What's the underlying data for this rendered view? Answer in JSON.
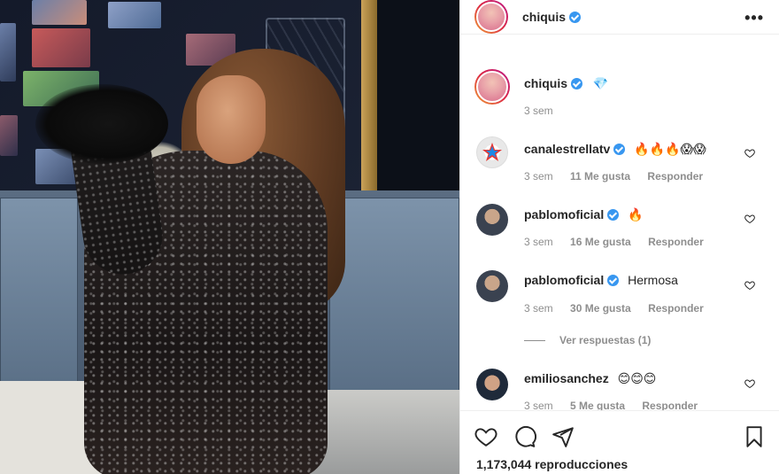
{
  "post": {
    "author": "chiquis",
    "caption_emoji": "💎",
    "caption_time": "3 sem",
    "views": "1,173,044 reproducciones"
  },
  "comments": [
    {
      "user": "canalestrellatv",
      "text": "🔥🔥🔥😱😱",
      "time": "3 sem",
      "likes": "11 Me gusta",
      "reply": "Responder"
    },
    {
      "user": "pablomoficial",
      "text": "🔥",
      "time": "3 sem",
      "likes": "16 Me gusta",
      "reply": "Responder"
    },
    {
      "user": "pablomoficial",
      "text": "Hermosa",
      "time": "3 sem",
      "likes": "30 Me gusta",
      "reply": "Responder",
      "replies_label": "Ver respuestas (1)"
    },
    {
      "user": "emiliosanchez",
      "text": "😊😊😊",
      "time": "3 sem",
      "likes": "5 Me gusta",
      "reply": "Responder"
    }
  ],
  "icons": {
    "like": "heart-icon",
    "comment": "comment-icon",
    "share": "share-icon",
    "save": "bookmark-icon",
    "more": "more-options-icon",
    "verified": "verified-badge-icon"
  },
  "colors": {
    "verified": "#3897f0",
    "text": "#262626",
    "muted": "#8e8e8e"
  }
}
